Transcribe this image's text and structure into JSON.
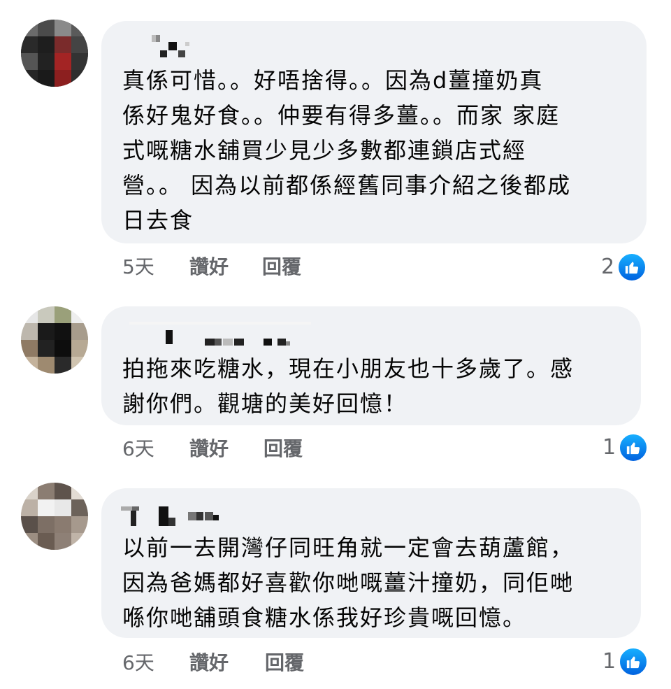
{
  "comments": [
    {
      "lines": [
        "真係可惜。。好唔捨得。。因為d薑撞奶真",
        "係好鬼好食。。仲要有得多薑。。而家 家庭",
        "式嘅糖水舖買少見少多數都連鎖店式經",
        "營。。 因為以前都係經舊同事介紹之後都成",
        "日去食"
      ],
      "time": "5天",
      "like_label": "讚好",
      "reply_label": "回覆",
      "reaction_count": "2",
      "reaction_icon": "like-icon"
    },
    {
      "lines": [
        "拍拖來吃糖水，現在小朋友也十多歲了。感",
        "謝你們。觀塘的美好回憶！"
      ],
      "time": "6天",
      "like_label": "讚好",
      "reply_label": "回覆",
      "reaction_count": "1",
      "reaction_icon": "like-icon"
    },
    {
      "lines": [
        "以前一去開灣仔同旺角就一定會去葫蘆館，",
        "因為爸媽都好喜歡你哋嘅薑汁撞奶，同佢哋",
        "喺你哋舖頭食糖水係我好珍貴嘅回憶。"
      ],
      "time": "6天",
      "like_label": "讚好",
      "reply_label": "回覆",
      "reaction_count": "1",
      "reaction_icon": "like-icon"
    }
  ],
  "colors": {
    "bubble": "#f0f2f5",
    "meta_text": "#65676b",
    "like_blue": "#0866ff"
  }
}
